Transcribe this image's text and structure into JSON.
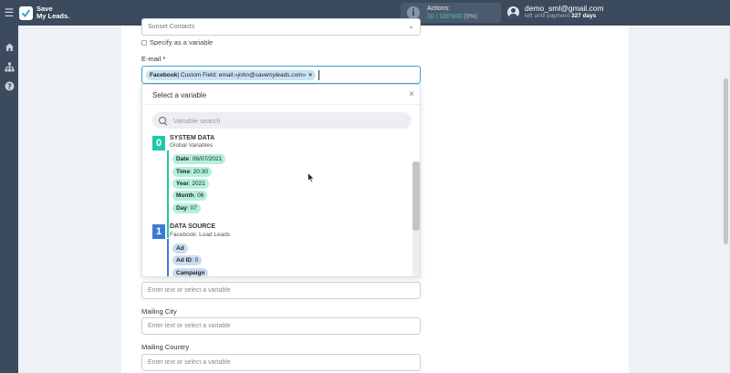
{
  "brand": {
    "line1": "Save",
    "line2": "My Leads."
  },
  "actions": {
    "label": "Actions:",
    "count": "10 / 100'000",
    "pct": "(0%)"
  },
  "account": {
    "email": "demo_sml@gmail.com",
    "sub_prefix": "left until payment",
    "days": "327 days"
  },
  "form": {
    "top_select_value": "Sunset Contacts",
    "specify_label": "Specify as a variable",
    "email_label": "E-mail",
    "required_mark": "*",
    "email_tag": {
      "source": "Facebook",
      "sep": " | Custom Field: email: ",
      "value": "«john@savemyleads.com»",
      "remove": "×"
    },
    "placeholder": "Enter text or select a variable",
    "mailing_city_label": "Mailing City",
    "mailing_country_label": "Mailing Country"
  },
  "dropdown": {
    "title": "Select a variable",
    "close": "×",
    "search_placeholder": "Variable search",
    "groups": [
      {
        "num": "0",
        "title": "SYSTEM DATA",
        "sub": "Global Variables",
        "items": [
          {
            "key": "Date",
            "value": ": 06/07/2021"
          },
          {
            "key": "Time",
            "value": ": 20:30"
          },
          {
            "key": "Year",
            "value": ": 2021"
          },
          {
            "key": "Month",
            "value": ": 06"
          },
          {
            "key": "Day",
            "value": ": 07"
          }
        ]
      },
      {
        "num": "1",
        "title": "DATA SOURCE",
        "sub": "Facebook: Load Leads",
        "items": [
          {
            "key": "Ad",
            "value": ""
          },
          {
            "key": "Ad ID",
            "value": ": 0"
          },
          {
            "key": "Campaign",
            "value": ""
          }
        ]
      }
    ]
  },
  "colors": {
    "topbar": "#3b4a5c",
    "accent_green": "#1fc9a4",
    "accent_blue": "#3a7bd5",
    "focus": "#3aa0d8"
  },
  "icons": {
    "menu": "menu-icon",
    "home": "home-icon",
    "sitemap": "sitemap-icon",
    "help": "help-icon",
    "info": "info-icon",
    "user": "user-icon",
    "search": "search-icon",
    "close": "close-icon",
    "chevron": "chevron-down-icon"
  }
}
